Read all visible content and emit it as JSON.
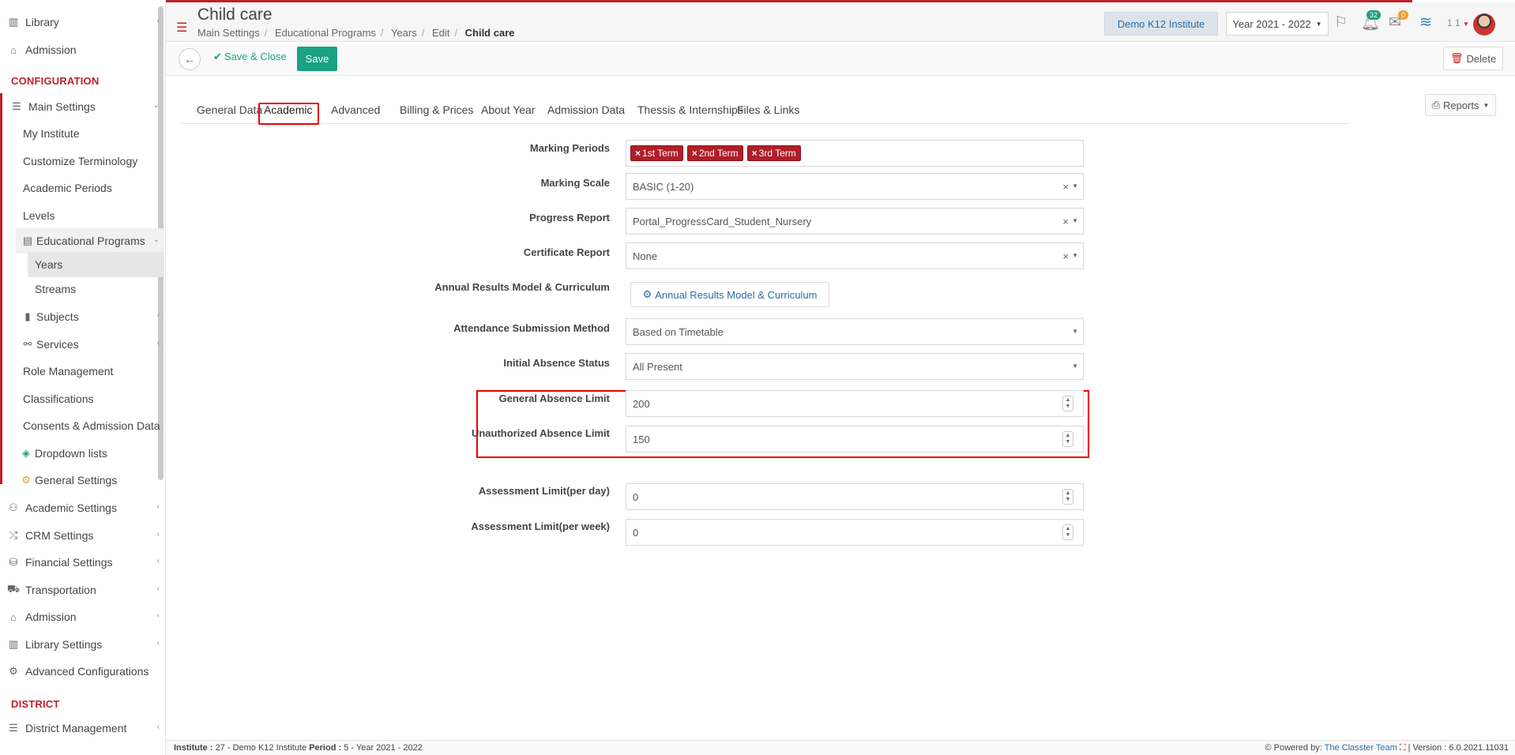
{
  "sidebar": {
    "top_items": [
      {
        "label": "Library",
        "icon": "books-icon"
      },
      {
        "label": "Admission",
        "icon": "institution-icon"
      }
    ],
    "config_heading": "CONFIGURATION",
    "main_settings": "Main Settings",
    "main_sub": [
      "My Institute",
      "Customize Terminology",
      "Academic Periods",
      "Levels"
    ],
    "educational_programs": "Educational Programs",
    "years": "Years",
    "streams": "Streams",
    "subjects": "Subjects",
    "services": "Services",
    "role_management": "Role Management",
    "classifications": "Classifications",
    "consents": "Consents & Admission Data",
    "dropdown_lists": "Dropdown lists",
    "general_settings": "General Settings",
    "groups": [
      {
        "label": "Academic Settings",
        "icon": "people-icon"
      },
      {
        "label": "CRM Settings",
        "icon": "shuffle-icon"
      },
      {
        "label": "Financial Settings",
        "icon": "coins-icon"
      },
      {
        "label": "Transportation",
        "icon": "bus-icon"
      },
      {
        "label": "Admission",
        "icon": "institution-icon"
      },
      {
        "label": "Library Settings",
        "icon": "books-icon"
      },
      {
        "label": "Advanced Configurations",
        "icon": "gears-icon"
      }
    ],
    "district_heading": "DISTRICT",
    "district_management": "District Management"
  },
  "header": {
    "title": "Child care",
    "breadcrumb": [
      "Main Settings",
      "Educational Programs",
      "Years",
      "Edit"
    ],
    "breadcrumb_current": "Child care",
    "institute": "Demo K12 Institute",
    "year": "Year 2021 - 2022",
    "notif_count": "32",
    "mail_count": "0",
    "user": "1 1"
  },
  "toolbar": {
    "save_close": "Save & Close",
    "save": "Save",
    "delete": "Delete"
  },
  "tabs": [
    "General Data",
    "Academic",
    "Advanced",
    "Billing & Prices",
    "About Year",
    "Admission Data",
    "Thessis & Internships",
    "Files & Links"
  ],
  "reports": "Reports",
  "form": {
    "marking_periods_label": "Marking Periods",
    "marking_periods": [
      "1st Term",
      "2nd Term",
      "3rd Term"
    ],
    "marking_scale_label": "Marking Scale",
    "marking_scale": "BASIC (1-20)",
    "progress_report_label": "Progress Report",
    "progress_report": "Portal_ProgressCard_Student_Nursery",
    "certificate_report_label": "Certificate Report",
    "certificate_report": "None",
    "annual_results_label": "Annual Results Model & Curriculum",
    "annual_results_button": "Annual Results Model & Curriculum",
    "attendance_method_label": "Attendance Submission Method",
    "attendance_method": "Based on Timetable",
    "initial_absence_label": "Initial Absence Status",
    "initial_absence": "All Present",
    "general_absence_label": "General Absence Limit",
    "general_absence": "200",
    "unauthorized_absence_label": "Unauthorized Absence Limit",
    "unauthorized_absence": "150",
    "assessment_day_label": "Assessment Limit(per day)",
    "assessment_day": "0",
    "assessment_week_label": "Assessment Limit(per week)",
    "assessment_week": "0"
  },
  "footer": {
    "institute_label": "Institute :",
    "institute_value": "27 - Demo K12 Institute",
    "period_label": "Period :",
    "period_value": "5 - Year 2021 - 2022",
    "powered_by": "Powered by:",
    "team": "The Classter Team",
    "version": "| Version : 6.0.2021.11031"
  },
  "colors": {
    "accent": "#c0202a",
    "primary": "#1aa283",
    "link": "#2c6aa5"
  }
}
